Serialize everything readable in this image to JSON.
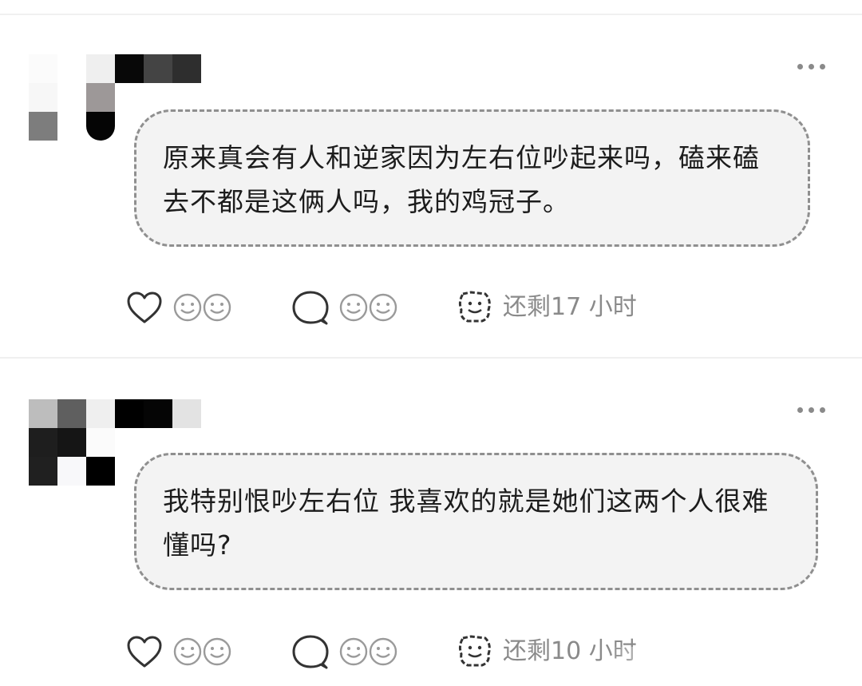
{
  "comments": [
    {
      "text": "原来真会有人和逆家因为左右位吵起来吗，磕来磕去不都是这俩人吗，我的鸡冠子。",
      "icons": {
        "like": "heart-outline-icon",
        "like_reacts": "two-smiley-faces-icon",
        "reply": "speech-bubble-icon",
        "reply_reacts": "two-smiley-faces-icon",
        "timer": "smiling-cloud-icon"
      },
      "timer": "还剩17 小时"
    },
    {
      "text": "我特别恨吵左右位 我喜欢的就是她们这两个人很难懂吗?",
      "icons": {
        "like": "heart-outline-icon",
        "like_reacts": "two-smiley-faces-icon",
        "reply": "speech-bubble-icon",
        "reply_reacts": "two-smiley-faces-icon",
        "timer": "smiling-cloud-icon"
      },
      "timer": "还剩10 小时"
    }
  ],
  "colors": {
    "bubble_bg": "#f3f3f3",
    "bubble_border": "#8f8f8f",
    "icon_stroke": "#333333",
    "icon_light": "#9a9a9a",
    "meta_text": "#8a8a8a"
  }
}
